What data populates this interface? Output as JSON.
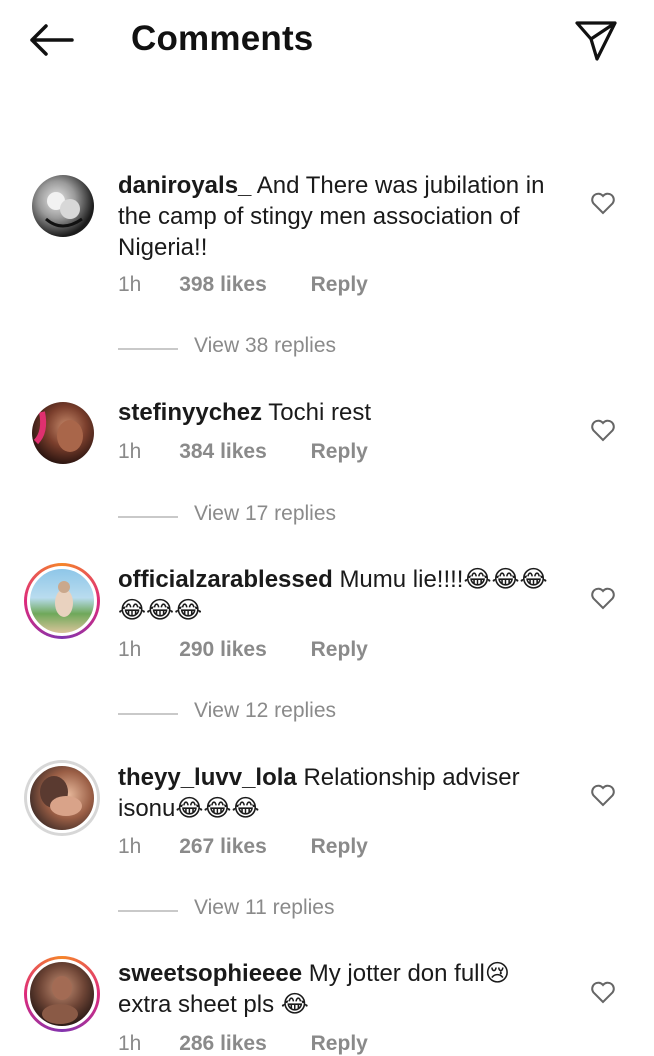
{
  "header": {
    "title": "Comments",
    "back_icon": "arrow-left-icon",
    "send_icon": "paper-plane-icon"
  },
  "comments": [
    {
      "username": "daniroyals_",
      "text": "And There was jubilation in the camp of stingy men association of Nigeria!!",
      "time": "1h",
      "likes": "398 likes",
      "reply": "Reply",
      "view_replies": "View 38 replies"
    },
    {
      "username": "stefinyychez",
      "text": "Tochi rest",
      "time": "1h",
      "likes": "384 likes",
      "reply": "Reply",
      "view_replies": "View 17 replies"
    },
    {
      "username": "officialzarablessed",
      "text": "Mumu lie!!!!😂😂😂😂😂😂",
      "time": "1h",
      "likes": "290 likes",
      "reply": "Reply",
      "view_replies": "View 12 replies"
    },
    {
      "username": "theyy_luvv_lola",
      "text": "Relationship adviser isonu😂😂😂",
      "time": "1h",
      "likes": "267 likes",
      "reply": "Reply",
      "view_replies": "View 11 replies"
    },
    {
      "username": "sweetsophieeee",
      "text": "My jotter don full😢 extra sheet pls 😂",
      "time": "1h",
      "likes": "286 likes",
      "reply": "Reply"
    }
  ],
  "colors": {
    "story_ring_start": "#f58529",
    "story_ring_end": "#dd2a7b",
    "meta_text": "#8a8a8a"
  }
}
